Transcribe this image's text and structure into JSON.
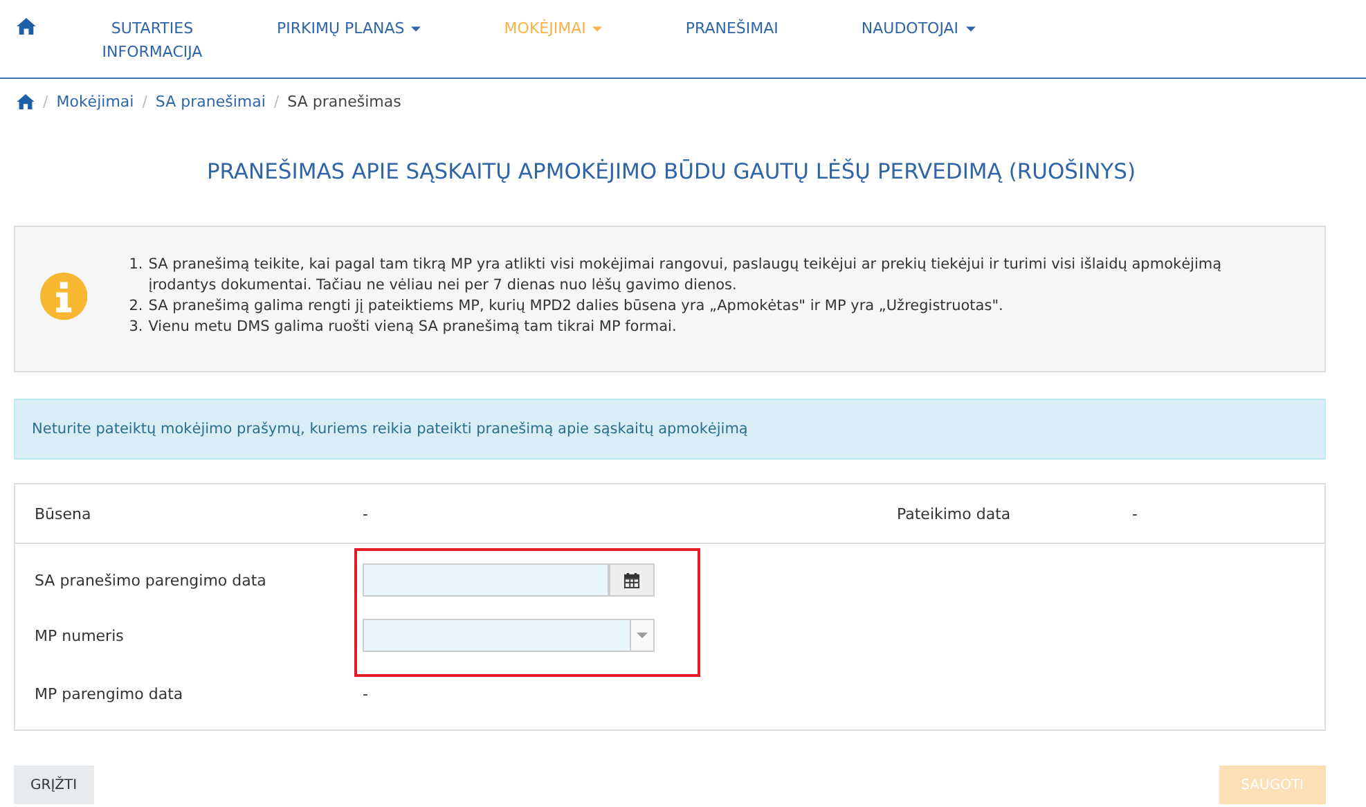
{
  "nav": {
    "items": [
      {
        "label": "SUTARTIES INFORMACIJA",
        "dropdown": false,
        "selected": false
      },
      {
        "label": "PIRKIMŲ PLANAS",
        "dropdown": true,
        "selected": false
      },
      {
        "label": "MOKĖJIMAI",
        "dropdown": true,
        "selected": true
      },
      {
        "label": "PRANEŠIMAI",
        "dropdown": false,
        "selected": false
      },
      {
        "label": "NAUDOTOJAI",
        "dropdown": true,
        "selected": false
      }
    ]
  },
  "breadcrumb": [
    {
      "separator": "/",
      "label": "Mokėjimai"
    },
    {
      "separator": "/",
      "label": "SA pranešimai"
    },
    {
      "separator": "/",
      "label": "SA pranešimas"
    }
  ],
  "title": "PRANEŠIMAS APIE SĄSKAITŲ APMOKĖJIMO BŪDU GAUTŲ LĖŠŲ PERVEDIMĄ (RUOŠINYS)",
  "info": [
    {
      "number": "1.",
      "text": "SA pranešimą teikite, kai pagal tam tikrą MP yra atlikti visi mokėjimai rangovui, paslaugų teikėjui ar prekių tiekėjui ir turimi visi išlaidų apmokėjimą įrodantys dokumentai. Tačiau ne vėliau nei per 7 dienas nuo lėšų gavimo dienos."
    },
    {
      "number": "2.",
      "text": "SA pranešimą galima rengti jį pateiktiems MP, kurių MPD2 dalies būsena yra „Apmokėtas\" ir MP yra „Užregistruotas\"."
    },
    {
      "number": "3.",
      "text": "Vienu metu DMS galima ruošti vieną SA pranešimą tam tikrai MP formai."
    }
  ],
  "alert": "Neturite pateiktų mokėjimo prašymų, kuriems reikia pateikti pranešimą apie sąskaitų apmokėjimą",
  "form": {
    "status": {
      "label": "Būsena",
      "value": "-",
      "date_label": "Pateikimo data",
      "date_value": "-"
    },
    "highlighted": true,
    "fields": [
      {
        "label": "SA pranešimo parengimo data",
        "kind": "date"
      },
      {
        "label": "MP numeris",
        "kind": "select"
      }
    ],
    "mp_date": {
      "label": "MP parengimo data",
      "value": "-"
    }
  },
  "buttons": [
    {
      "label": "GRĮŽTI",
      "kind": "back",
      "disabled": false
    },
    {
      "label": "SAUGOTI",
      "kind": "save",
      "disabled": true
    }
  ]
}
